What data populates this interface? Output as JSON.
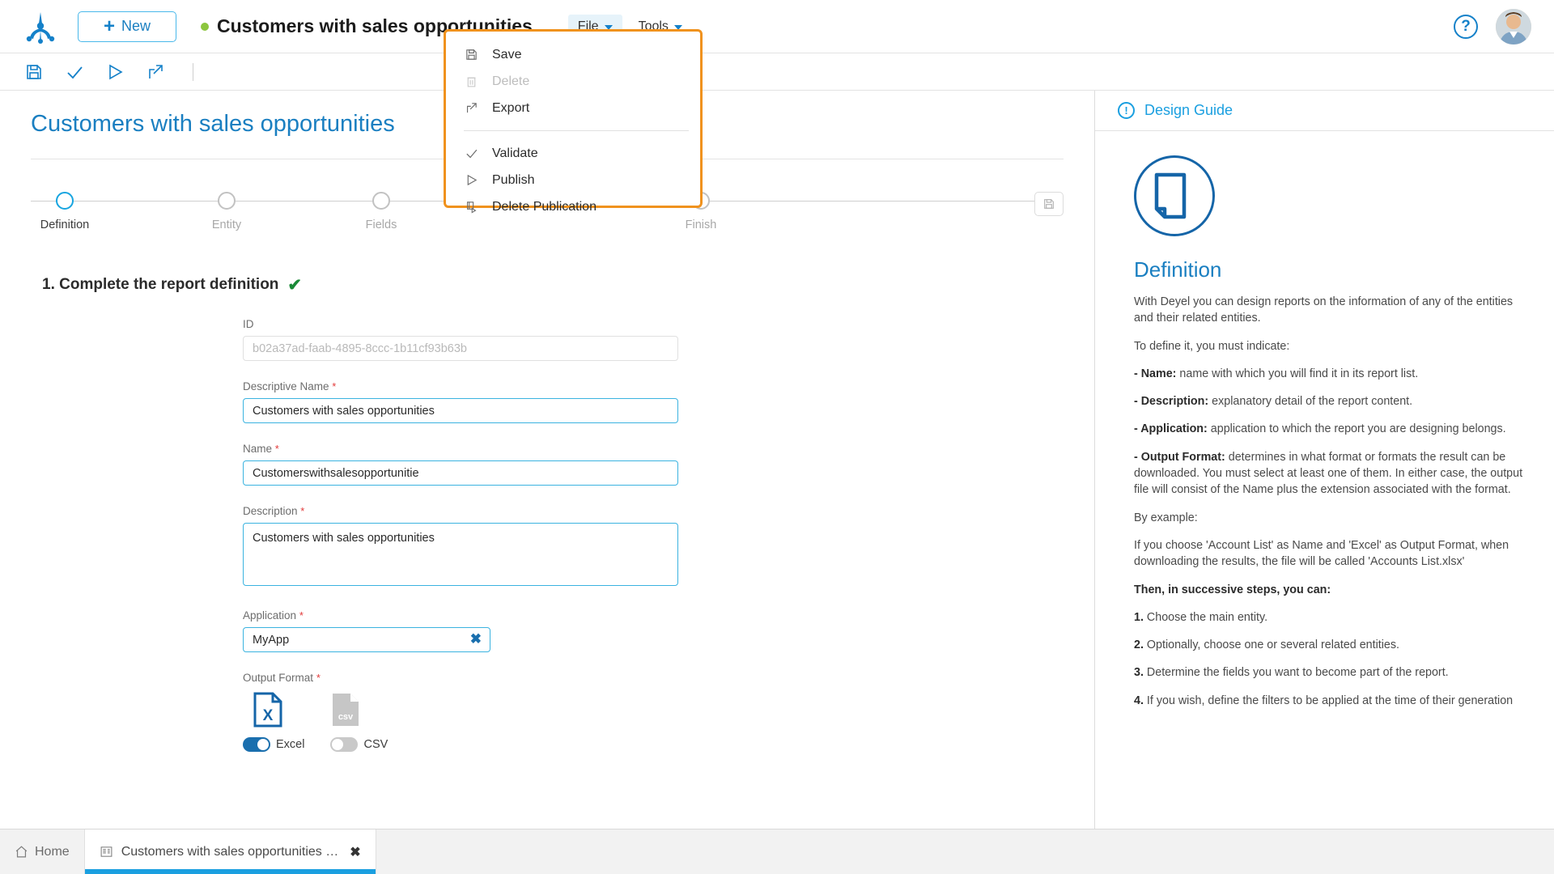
{
  "topbar": {
    "logo_name": "deyel-logo",
    "new_button": "New",
    "document_title": "Customers with sales opportunities",
    "status_dot_color": "#8cc63e",
    "menus": [
      {
        "label": "File",
        "open": true
      },
      {
        "label": "Tools",
        "open": false
      }
    ],
    "help_label": "?",
    "avatar_name": "user-avatar"
  },
  "toolstrip": {
    "tools": [
      {
        "name": "save-icon",
        "title": "Save"
      },
      {
        "name": "validate-check-icon",
        "title": "Validate"
      },
      {
        "name": "publish-play-icon",
        "title": "Publish"
      },
      {
        "name": "export-arrow-icon",
        "title": "Export"
      }
    ]
  },
  "file_menu": {
    "border_color": "#f0921e",
    "groups": [
      [
        {
          "label": "Save",
          "icon": "save-icon",
          "disabled": false
        },
        {
          "label": "Delete",
          "icon": "trash-icon",
          "disabled": true
        },
        {
          "label": "Export",
          "icon": "export-arrow-icon",
          "disabled": false
        }
      ],
      [
        {
          "label": "Validate",
          "icon": "check-icon",
          "disabled": false
        },
        {
          "label": "Publish",
          "icon": "play-icon",
          "disabled": false
        },
        {
          "label": "Delete Publication",
          "icon": "unpublish-icon",
          "disabled": false
        }
      ]
    ]
  },
  "main": {
    "page_title": "Customers with sales opportunities",
    "stepper": {
      "steps": [
        {
          "label": "Definition",
          "active": true
        },
        {
          "label": "Entity",
          "active": false
        },
        {
          "label": "Fields",
          "active": false
        },
        {
          "label": "Finish",
          "active": false
        }
      ],
      "end_icon": "save-icon"
    },
    "section": {
      "heading": "1. Complete the report definition",
      "complete_check": "✔"
    },
    "fields": {
      "id": {
        "label": "ID",
        "required": false,
        "value": "",
        "placeholder": "b02a37ad-faab-4895-8ccc-1b11cf93b63b"
      },
      "descriptive_name": {
        "label": "Descriptive Name",
        "required": true,
        "value": "Customers with sales opportunities"
      },
      "name": {
        "label": "Name",
        "required": true,
        "value": "Customerswithsalesopportunitie"
      },
      "description": {
        "label": "Description",
        "required": true,
        "value": "Customers with sales opportunities"
      },
      "application": {
        "label": "Application",
        "required": true,
        "value": "MyApp",
        "clear_icon": "clear-x-icon"
      },
      "output_format": {
        "label": "Output Format",
        "required": true,
        "options": [
          {
            "label": "Excel",
            "icon": "excel-file-icon",
            "enabled": true,
            "color": "#1a6fae"
          },
          {
            "label": "CSV",
            "icon": "csv-file-icon",
            "enabled": false,
            "color": "#c6c6c6"
          }
        ]
      }
    }
  },
  "guide": {
    "header_title": "Design Guide",
    "header_icon": "info-exclamation-icon",
    "hero_icon": "document-page-icon",
    "title": "Definition",
    "paragraphs": [
      {
        "text": "With Deyel you can design reports on the information of any of the entities and their related entities.",
        "bold_prefix": ""
      },
      {
        "text": "To define it, you must indicate:",
        "bold_prefix": ""
      },
      {
        "text": "name with which you will find it in its report list.",
        "bold_prefix": "- Name:"
      },
      {
        "text": "explanatory detail of the report content.",
        "bold_prefix": "- Description:"
      },
      {
        "text": "application to which the report you are designing belongs.",
        "bold_prefix": "- Application:"
      },
      {
        "text": "determines in what format or formats the result can be downloaded. You must select at least one of them. In either case, the output file will consist of the Name plus the extension associated with the format.",
        "bold_prefix": "- Output Format:"
      },
      {
        "text": "By example:",
        "bold_prefix": ""
      },
      {
        "text": "If you choose 'Account List' as Name and 'Excel' as Output Format, when downloading the results, the file will be called 'Accounts List.xlsx'",
        "bold_prefix": ""
      },
      {
        "text": "",
        "bold_prefix": "Then, in successive steps, you can:"
      },
      {
        "text": "Choose the main entity.",
        "bold_prefix": "1."
      },
      {
        "text": "Optionally, choose one or several related entities.",
        "bold_prefix": "2."
      },
      {
        "text": "Determine the fields you want to become part of the report.",
        "bold_prefix": "3."
      },
      {
        "text": "If you wish, define the filters to be applied at the time of their generation",
        "bold_prefix": "4."
      }
    ]
  },
  "taskbar": {
    "home_label": "Home",
    "home_icon": "home-icon",
    "tab": {
      "label": "Customers with sales opportunities …",
      "icon": "report-document-icon",
      "close_icon": "close-x-icon",
      "active": true
    }
  }
}
